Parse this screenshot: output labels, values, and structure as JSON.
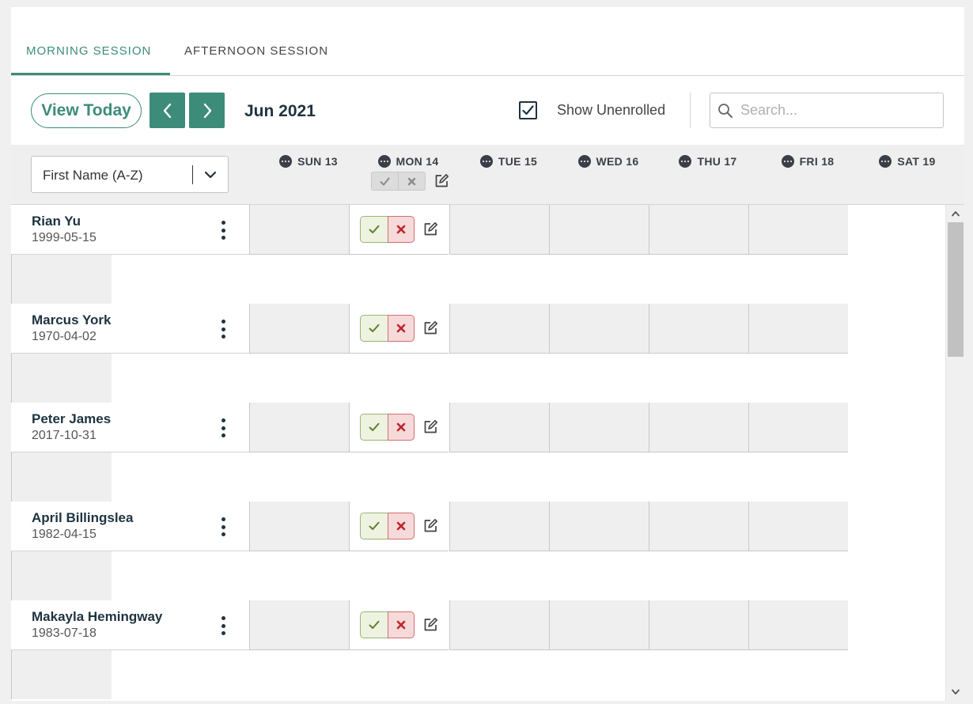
{
  "tabs": [
    {
      "label": "MORNING SESSION",
      "active": true
    },
    {
      "label": "AFTERNOON SESSION",
      "active": false
    }
  ],
  "toolbar": {
    "view_today_label": "View Today",
    "prev_icon": "chevron-left-icon",
    "next_icon": "chevron-right-icon",
    "month_label": "Jun 2021",
    "show_unenrolled_label": "Show Unenrolled",
    "show_unenrolled_checked": true,
    "search_placeholder": "Search...",
    "search_value": ""
  },
  "sort": {
    "selected": "First Name (A-Z)"
  },
  "days": [
    {
      "label": "SUN 13"
    },
    {
      "label": "MON 14"
    },
    {
      "label": "TUE 15"
    },
    {
      "label": "WED 16"
    },
    {
      "label": "THU 17"
    },
    {
      "label": "FRI 18"
    },
    {
      "label": "SAT 19"
    }
  ],
  "people": [
    {
      "name": "Rian Yu",
      "dob": "1999-05-15"
    },
    {
      "name": "Marcus York",
      "dob": "1970-04-02"
    },
    {
      "name": "Peter James",
      "dob": "2017-10-31"
    },
    {
      "name": "April Billingslea",
      "dob": "1982-04-15"
    },
    {
      "name": "Makayla Hemingway",
      "dob": "1983-07-18"
    }
  ],
  "colors": {
    "accent": "#3d8c7a",
    "dark_text": "#1e3340",
    "present_bg": "#eef3e1",
    "present_border": "#97b673",
    "present_check": "#5f7f31",
    "absent_bg": "#f6dada",
    "absent_border": "#d36e6e",
    "absent_x": "#c0272d"
  }
}
